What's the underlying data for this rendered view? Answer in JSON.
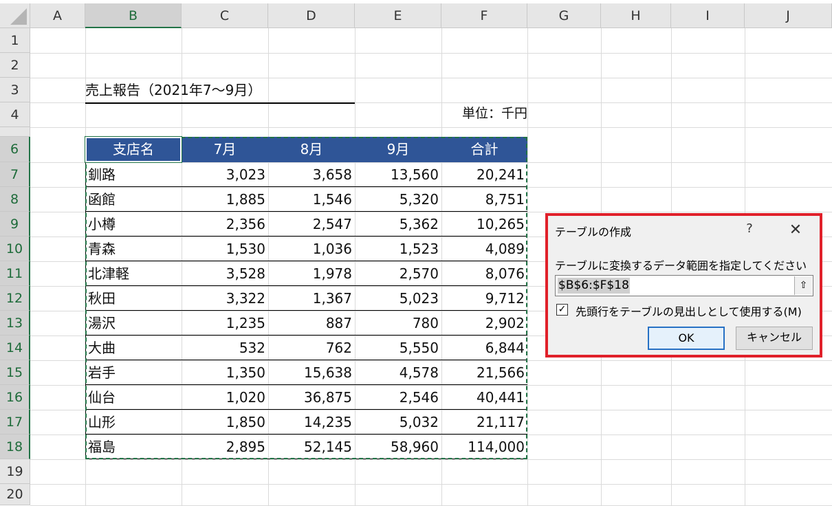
{
  "columns": [
    "A",
    "B",
    "C",
    "D",
    "E",
    "F",
    "G",
    "H",
    "I",
    "J"
  ],
  "rows": [
    "1",
    "2",
    "3",
    "4",
    "6",
    "7",
    "8",
    "9",
    "10",
    "11",
    "12",
    "13",
    "14",
    "15",
    "16",
    "17",
    "18",
    "19",
    "20"
  ],
  "report": {
    "title": "売上報告（2021年7～9月）",
    "unit": "単位：千円"
  },
  "table": {
    "headers": [
      "支店名",
      "7月",
      "8月",
      "9月",
      "合計"
    ],
    "rows": [
      [
        "釧路",
        "3,023",
        "3,658",
        "13,560",
        "20,241"
      ],
      [
        "函館",
        "1,885",
        "1,546",
        "5,320",
        "8,751"
      ],
      [
        "小樽",
        "2,356",
        "2,547",
        "5,362",
        "10,265"
      ],
      [
        "青森",
        "1,530",
        "1,036",
        "1,523",
        "4,089"
      ],
      [
        "北津軽",
        "3,528",
        "1,978",
        "2,570",
        "8,076"
      ],
      [
        "秋田",
        "3,322",
        "1,367",
        "5,023",
        "9,712"
      ],
      [
        "湯沢",
        "1,235",
        "887",
        "780",
        "2,902"
      ],
      [
        "大曲",
        "532",
        "762",
        "5,550",
        "6,844"
      ],
      [
        "岩手",
        "1,350",
        "15,638",
        "4,578",
        "21,566"
      ],
      [
        "仙台",
        "1,020",
        "36,875",
        "2,546",
        "40,441"
      ],
      [
        "山形",
        "1,850",
        "14,235",
        "5,032",
        "21,117"
      ],
      [
        "福島",
        "2,895",
        "52,145",
        "58,960",
        "114,000"
      ]
    ]
  },
  "dialog": {
    "title": "テーブルの作成",
    "help": "?",
    "close": "✕",
    "prompt": "テーブルに変換するデータ範囲を指定してください(W)",
    "range_value": "$B$6:$F$18",
    "collapse_icon": "⇧",
    "checkbox_checked": true,
    "checkbox_mark": "✓",
    "checkbox_label": "先頭行をテーブルの見出しとして使用する(M)",
    "ok_label": "OK",
    "cancel_label": "キャンセル"
  },
  "colors": {
    "header_fill": "#2f5597",
    "selection": "#217346",
    "dialog_border": "#e0202a"
  }
}
